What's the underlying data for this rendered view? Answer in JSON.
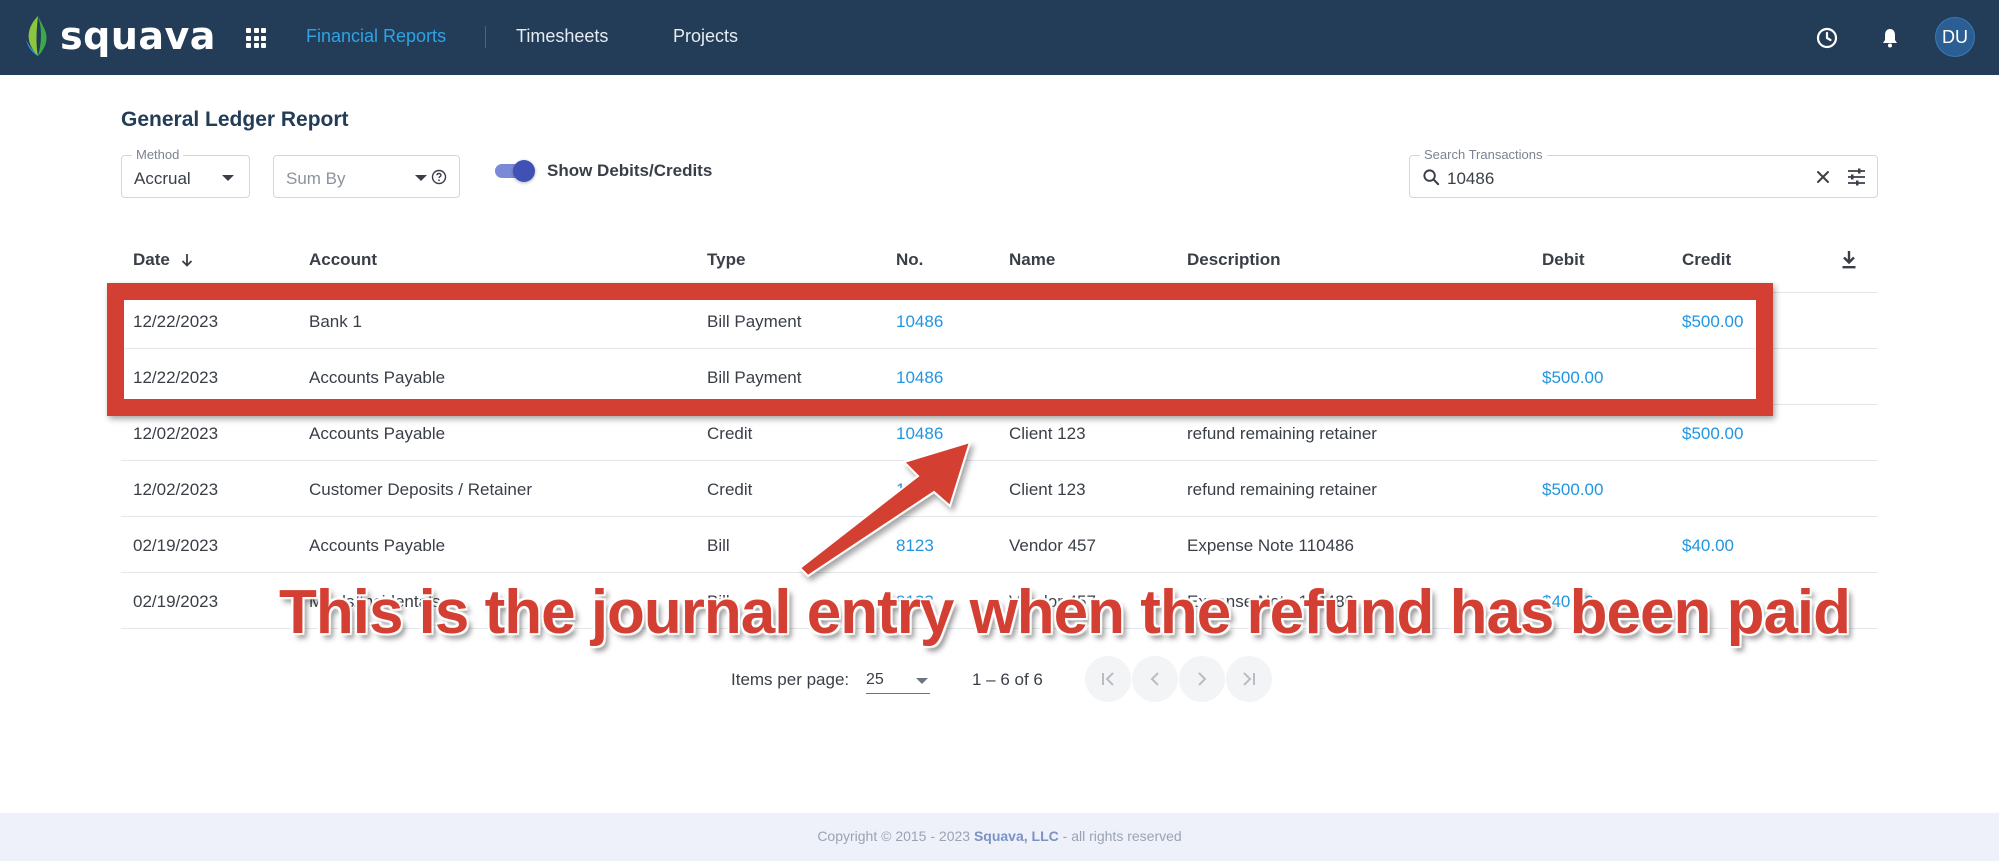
{
  "brand": {
    "name": "squava"
  },
  "nav": {
    "items": [
      {
        "label": "Financial Reports",
        "active": true
      },
      {
        "label": "Timesheets",
        "active": false
      },
      {
        "label": "Projects",
        "active": false
      }
    ],
    "avatar_initials": "DU",
    "icons": [
      "apps-grid-icon",
      "history-icon",
      "bell-icon"
    ]
  },
  "report": {
    "title": "General Ledger Report",
    "method": {
      "label": "Method",
      "value": "Accrual"
    },
    "sum_by": {
      "placeholder": "Sum By"
    },
    "toggle": {
      "label": "Show Debits/Credits",
      "on": true
    },
    "search": {
      "label": "Search Transactions",
      "value": "10486"
    }
  },
  "table": {
    "columns": [
      "Date",
      "Account",
      "Type",
      "No.",
      "Name",
      "Description",
      "Debit",
      "Credit"
    ],
    "rows": [
      {
        "date": "12/22/2023",
        "account": "Bank 1",
        "type": "Bill Payment",
        "no": "10486",
        "name": "",
        "description": "",
        "debit": "",
        "credit": "$500.00"
      },
      {
        "date": "12/22/2023",
        "account": "Accounts Payable",
        "type": "Bill Payment",
        "no": "10486",
        "name": "",
        "description": "",
        "debit": "$500.00",
        "credit": ""
      },
      {
        "date": "12/02/2023",
        "account": "Accounts Payable",
        "type": "Credit",
        "no": "10486",
        "name": "Client 123",
        "description": "refund remaining retainer",
        "debit": "",
        "credit": "$500.00"
      },
      {
        "date": "12/02/2023",
        "account": "Customer Deposits / Retainer",
        "type": "Credit",
        "no": "10486",
        "name": "Client 123",
        "description": "refund remaining retainer",
        "debit": "$500.00",
        "credit": ""
      },
      {
        "date": "02/19/2023",
        "account": "Accounts Payable",
        "type": "Bill",
        "no": "8123",
        "name": "Vendor 457",
        "description": "Expense Note 110486",
        "debit": "",
        "credit": "$40.00"
      },
      {
        "date": "02/19/2023",
        "account": "Meals/Incidentals",
        "type": "Bill",
        "no": "8123",
        "name": "Vendor 457",
        "description": "Expense Note 110486",
        "debit": "$40.00",
        "credit": ""
      }
    ]
  },
  "pagination": {
    "items_per_page_label": "Items per page:",
    "items_per_page": "25",
    "range": "1 – 6 of 6"
  },
  "footer": {
    "prefix": "Copyright © 2015 - 2023 ",
    "company": "Squava, LLC",
    "suffix": " - all rights reserved"
  },
  "annotation": {
    "text": "This is the journal entry when the refund has been paid",
    "color": "#d33f32"
  },
  "colors": {
    "topbar": "#233d58",
    "accent": "#2196e0",
    "toggle": "#3f51b5"
  }
}
